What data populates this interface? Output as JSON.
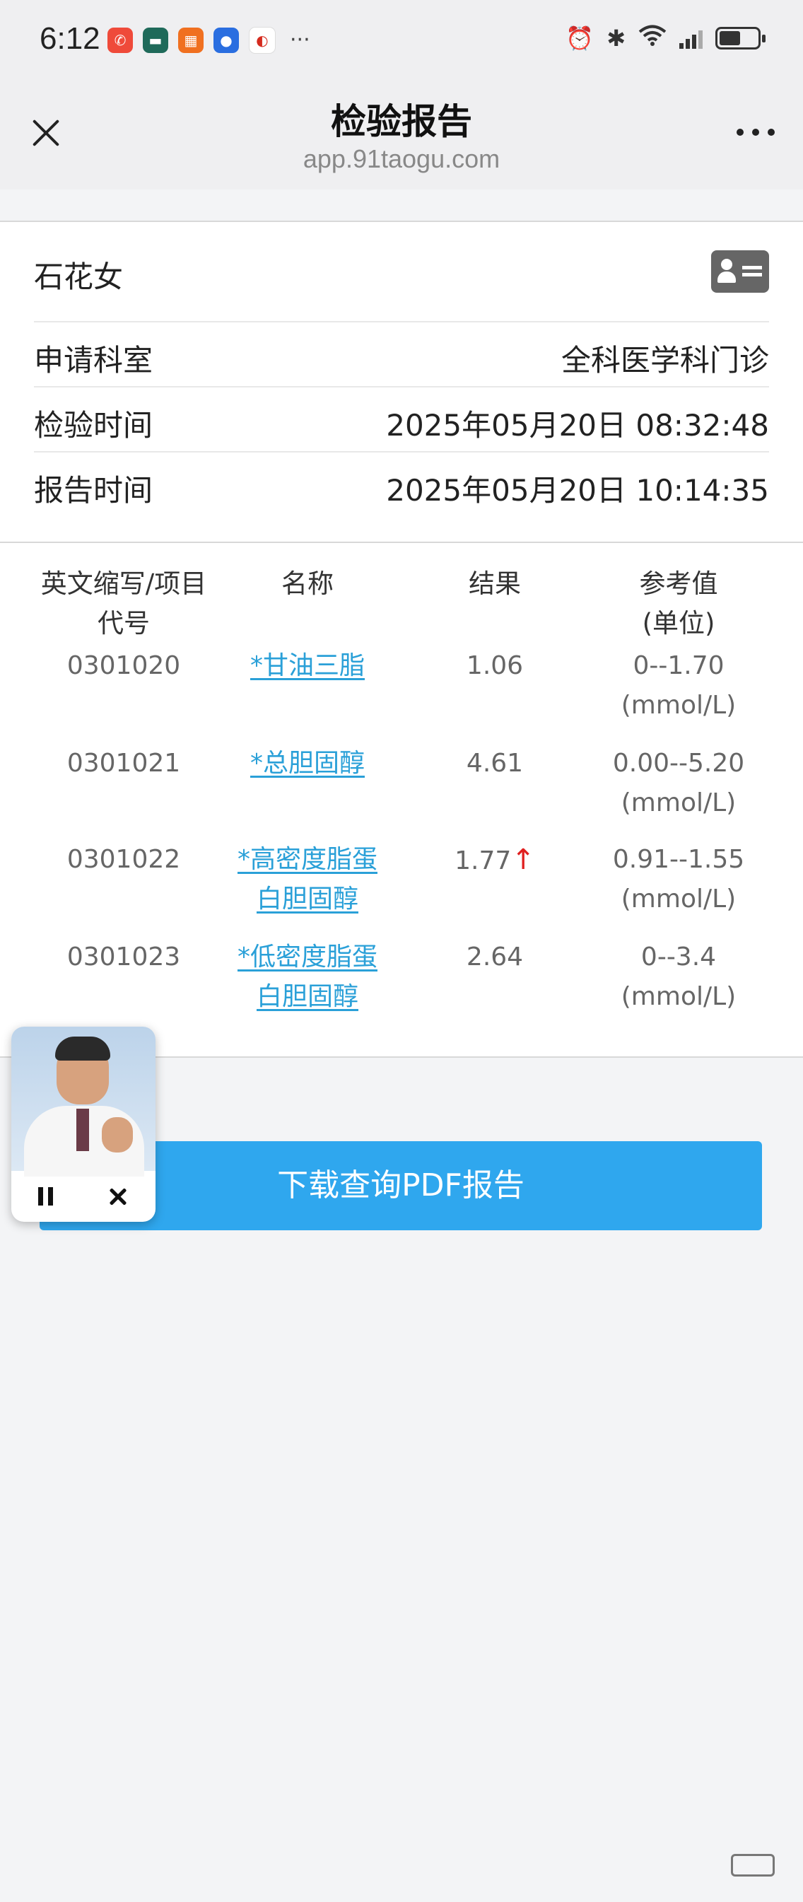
{
  "status_bar": {
    "time": "6:12",
    "more": "···",
    "app_icons": [
      {
        "name": "phone-app-icon",
        "color": "#ef4a3a",
        "glyph": "✆"
      },
      {
        "name": "news-app-icon",
        "color": "#1f6a5a",
        "glyph": "▬"
      },
      {
        "name": "grid-app-icon",
        "color": "#f07020",
        "glyph": "▦"
      },
      {
        "name": "blue-app-icon",
        "color": "#2a6ee0",
        "glyph": "●"
      },
      {
        "name": "weibo-app-icon",
        "color": "#ffffff",
        "glyph": "◐"
      }
    ],
    "battery_level": 0.55
  },
  "nav": {
    "title": "检验报告",
    "subtitle": "app.91taogu.com"
  },
  "patient": {
    "name": "石花女",
    "rows": [
      {
        "label": "申请科室",
        "value": "全科医学科门诊"
      },
      {
        "label": "检验时间",
        "value": "2025年05月20日 08:32:48"
      },
      {
        "label": "报告时间",
        "value": "2025年05月20日 10:14:35"
      }
    ]
  },
  "table": {
    "headers": {
      "code_line1": "英文缩写/项目",
      "code_line2": "代号",
      "name": "名称",
      "result": "结果",
      "ref_line1": "参考值",
      "ref_line2": "(单位)"
    },
    "rows": [
      {
        "code": "0301020",
        "name1": "*甘油三脂",
        "name2": "",
        "result": "1.06",
        "flag": "",
        "ref1": "0--1.70",
        "ref2": "(mmol/L)"
      },
      {
        "code": "0301021",
        "name1": "*总胆固醇",
        "name2": "",
        "result": "4.61",
        "flag": "",
        "ref1": "0.00--5.20",
        "ref2": "(mmol/L)"
      },
      {
        "code": "0301022",
        "name1": "*高密度脂蛋",
        "name2": "白胆固醇",
        "result": "1.77",
        "flag": "↑",
        "ref1": "0.91--1.55",
        "ref2": "(mmol/L)"
      },
      {
        "code": "0301023",
        "name1": "*低密度脂蛋",
        "name2": "白胆固醇",
        "result": "2.64",
        "flag": "",
        "ref1": "0--3.4",
        "ref2": "(mmol/L)"
      }
    ]
  },
  "download_button": "下载查询PDF报告"
}
